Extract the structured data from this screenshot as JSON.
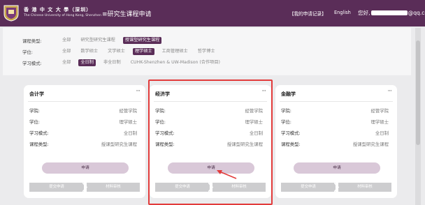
{
  "header": {
    "school_name_cn": "香 港 中 文 大 學（深圳）",
    "school_name_en": "The Chinese University of Hong Kong, Shenzhen",
    "system_title": "≡研究生课程申请",
    "my_applications": "【我的申请记录】",
    "language": "English",
    "greeting": "您好,",
    "email_suffix": "@qq.com",
    "accent_color": "#5a2d58"
  },
  "filters": [
    {
      "label": "课程类型:",
      "options": [
        {
          "text": "全部",
          "selected": false
        },
        {
          "text": "研究型研究生课程",
          "selected": false
        },
        {
          "text": "授课型研究生课程",
          "selected": true
        }
      ]
    },
    {
      "label": "学位:",
      "options": [
        {
          "text": "全部",
          "selected": false
        },
        {
          "text": "数学硕士",
          "selected": false
        },
        {
          "text": "文学硕士",
          "selected": false
        },
        {
          "text": "理学硕士",
          "selected": true
        },
        {
          "text": "工商管理硕士",
          "selected": false
        },
        {
          "text": "哲学博士",
          "selected": false
        }
      ]
    },
    {
      "label": "学习模式:",
      "options": [
        {
          "text": "全部",
          "selected": false
        },
        {
          "text": "全日制",
          "selected": true
        },
        {
          "text": "非全日制",
          "selected": false
        },
        {
          "text": "CUHK-Shenzhen & UW-Madison (合作项目)",
          "selected": false
        }
      ]
    }
  ],
  "cards": [
    {
      "title": "会计学",
      "more": "···",
      "fields": [
        {
          "label": "学院:",
          "value": "经管学院"
        },
        {
          "label": "学位:",
          "value": "理学硕士"
        },
        {
          "label": "学习模式:",
          "value": "全日制"
        },
        {
          "label": "课程类型:",
          "value": "授课型研究生课程"
        }
      ],
      "apply_label": "申请",
      "step1": "提交申请",
      "step2": "材料审核"
    },
    {
      "title": "经济学",
      "more": "···",
      "fields": [
        {
          "label": "学院:",
          "value": "经管学院"
        },
        {
          "label": "学位:",
          "value": "理学硕士"
        },
        {
          "label": "学习模式:",
          "value": "全日制"
        },
        {
          "label": "课程类型:",
          "value": "授课型研究生课程"
        }
      ],
      "apply_label": "申请",
      "step1": "提交申请",
      "step2": "材料审核"
    },
    {
      "title": "金融学",
      "more": "···",
      "fields": [
        {
          "label": "学院:",
          "value": "经管学院"
        },
        {
          "label": "学位:",
          "value": "理学硕士"
        },
        {
          "label": "学习模式:",
          "value": "全日制"
        },
        {
          "label": "课程类型:",
          "value": "授课型研究生课程"
        }
      ],
      "apply_label": "申请",
      "step1": "提交申请",
      "step2": "材料审核"
    }
  ],
  "annotation": {
    "color": "#e23b3b",
    "icon": "arrow-icon"
  }
}
